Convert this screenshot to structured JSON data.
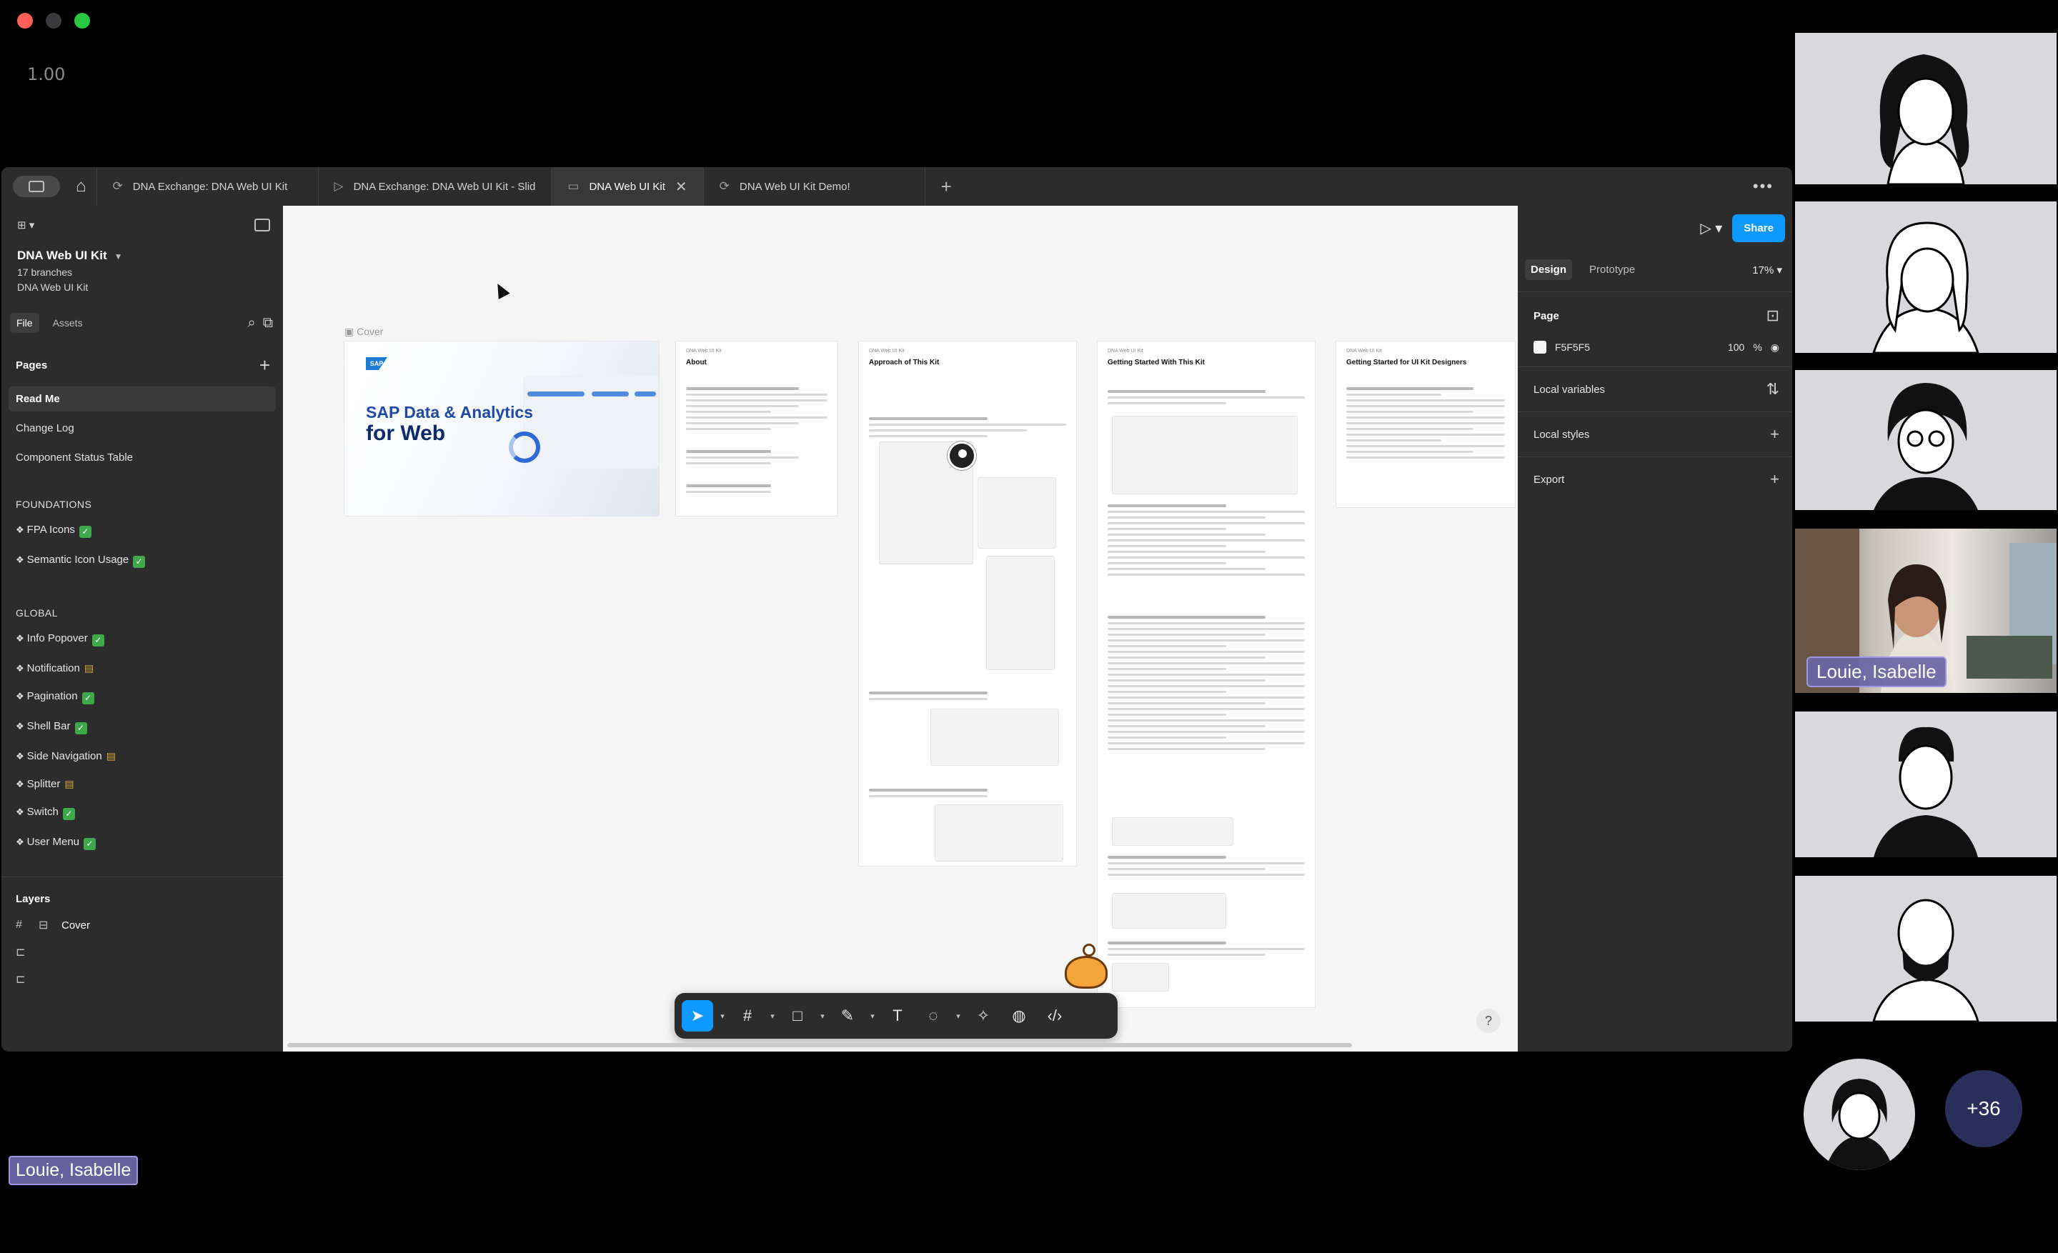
{
  "meeting": {
    "zoom_readout": "1.00",
    "active_speaker": "Louie, Isabelle",
    "more_participants": "+36"
  },
  "tabs": [
    {
      "label": "DNA Exchange: DNA Web UI Kit",
      "icon": "figma-file-icon"
    },
    {
      "label": "DNA Exchange: DNA Web UI Kit - Slid",
      "icon": "slides-play-icon"
    },
    {
      "label": "DNA Web UI Kit",
      "icon": "book-icon",
      "active": true
    },
    {
      "label": "DNA Web UI Kit Demo!",
      "icon": "figma-file-icon"
    }
  ],
  "file": {
    "title": "DNA Web UI Kit",
    "branches": "17 branches",
    "team": "DNA Web UI Kit",
    "tab_file": "File",
    "tab_assets": "Assets"
  },
  "pages": {
    "heading": "Pages",
    "items": [
      "Read Me",
      "Change Log",
      "Component Status Table"
    ],
    "groups": [
      {
        "title": "FOUNDATIONS",
        "items": [
          {
            "label": "FPA Icons",
            "status": "done"
          },
          {
            "label": "Semantic Icon Usage",
            "status": "done"
          }
        ]
      },
      {
        "title": "GLOBAL",
        "items": [
          {
            "label": "Info Popover",
            "status": "done"
          },
          {
            "label": "Notification",
            "status": "wip"
          },
          {
            "label": "Pagination",
            "status": "done"
          },
          {
            "label": "Shell Bar",
            "status": "done"
          },
          {
            "label": "Side Navigation",
            "status": "wip"
          },
          {
            "label": "Splitter",
            "status": "wip"
          },
          {
            "label": "Switch",
            "status": "done"
          },
          {
            "label": "User Menu",
            "status": "done"
          }
        ]
      }
    ]
  },
  "layers": {
    "heading": "Layers",
    "top_layer": "Cover"
  },
  "canvas": {
    "frame_label": "Cover",
    "cover": {
      "logo": "SAP",
      "title_line1": "SAP Data & Analytics",
      "title_line2": "for Web"
    },
    "frames": [
      {
        "kicker": "DNA Web UI Kit",
        "title": "About"
      },
      {
        "kicker": "DNA Web UI Kit",
        "title": "Approach of This Kit"
      },
      {
        "kicker": "DNA Web UI Kit",
        "title": "Getting Started With This Kit"
      },
      {
        "kicker": "DNA Web UI Kit",
        "title": "Getting Started for UI Kit Designers"
      }
    ]
  },
  "right_panel": {
    "share": "Share",
    "tab_design": "Design",
    "tab_prototype": "Prototype",
    "zoom": "17%",
    "page_heading": "Page",
    "page_color": "F5F5F5",
    "page_opacity": "100",
    "percent": "%",
    "local_variables": "Local variables",
    "local_styles": "Local styles",
    "export": "Export"
  },
  "colors": {
    "accent": "#0d99ff",
    "canvas_bg": "#F5F5F5",
    "done": "#3ea84a",
    "name_chip": "#6c65a6"
  }
}
